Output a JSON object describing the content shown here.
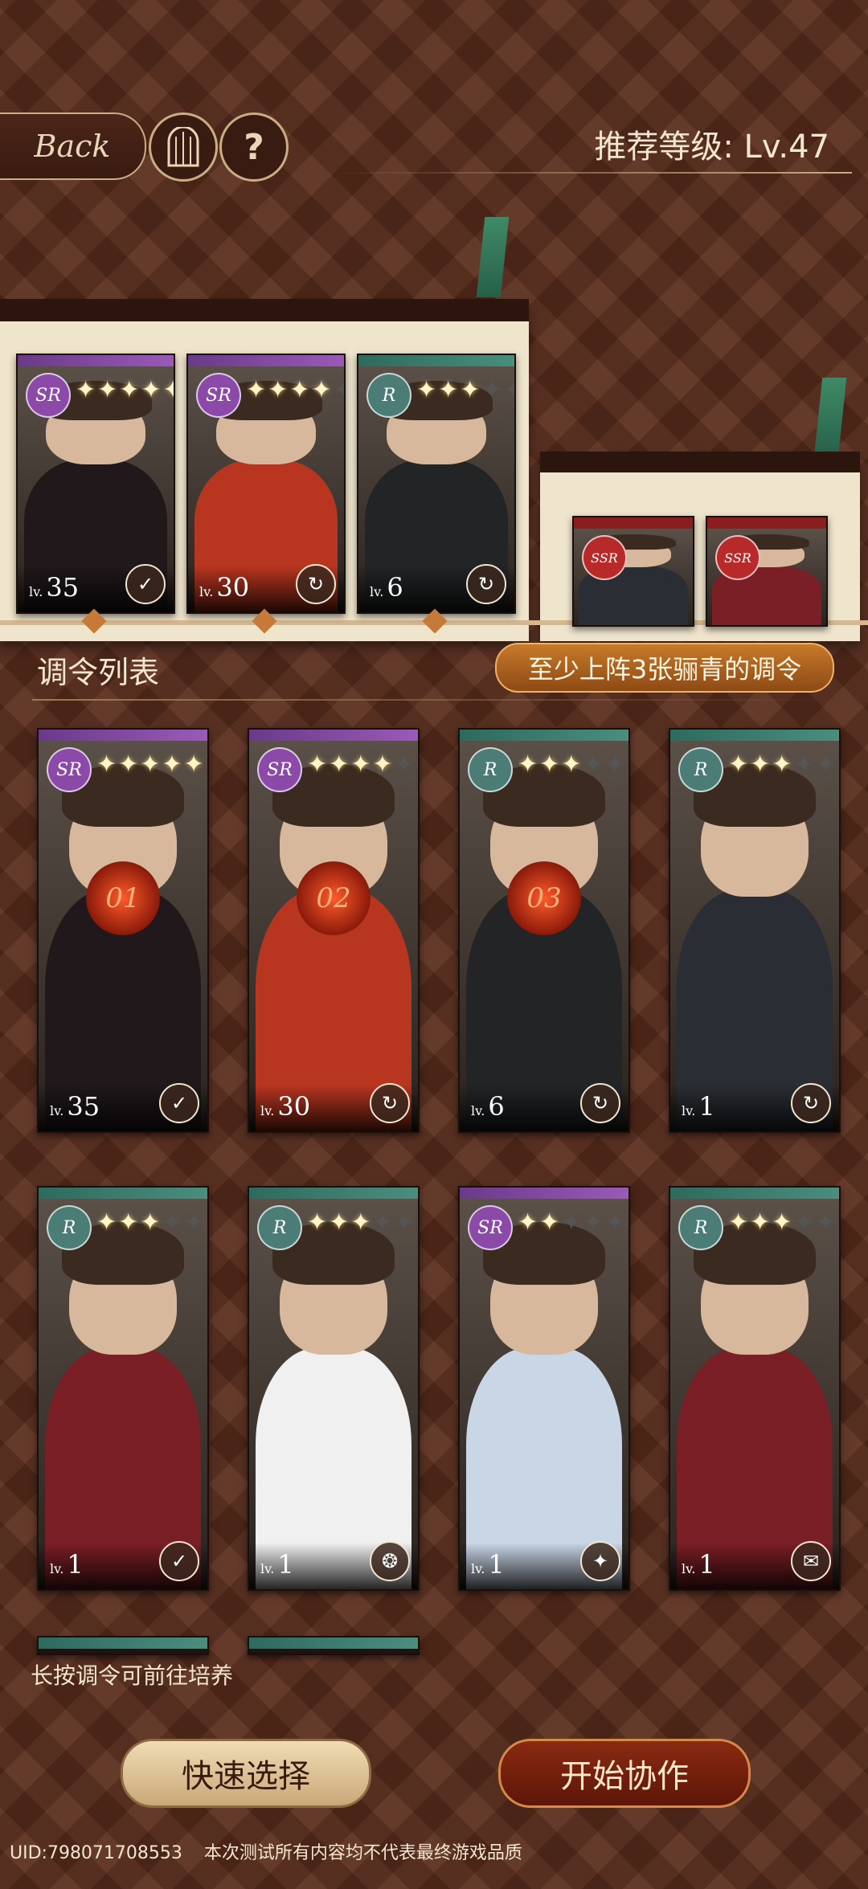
{
  "header": {
    "back_label": "Back",
    "recommended_level": "推荐等级: Lv.47"
  },
  "team_slots": [
    {
      "rarity": "SR",
      "stars": 5,
      "max_stars": 5,
      "level": "35",
      "skill": "✓"
    },
    {
      "rarity": "SR",
      "stars": 4,
      "max_stars": 5,
      "level": "30",
      "skill": "↻"
    },
    {
      "rarity": "R",
      "stars": 3,
      "max_stars": 5,
      "level": "6",
      "skill": "↻"
    }
  ],
  "support_slots": [
    {
      "rarity": "SSR"
    },
    {
      "rarity": "SSR"
    }
  ],
  "list": {
    "title": "调令列表",
    "requirement": "至少上阵3张骊青的调令",
    "cards": [
      {
        "rarity": "SR",
        "stars": 5,
        "max_stars": 5,
        "level": "35",
        "order": "01",
        "skill": "✓"
      },
      {
        "rarity": "SR",
        "stars": 4,
        "max_stars": 5,
        "level": "30",
        "order": "02",
        "skill": "↻"
      },
      {
        "rarity": "R",
        "stars": 3,
        "max_stars": 5,
        "level": "6",
        "order": "03",
        "skill": "↻"
      },
      {
        "rarity": "R",
        "stars": 3,
        "max_stars": 5,
        "level": "1",
        "order": "",
        "skill": "↻"
      },
      {
        "rarity": "R",
        "stars": 3,
        "max_stars": 5,
        "level": "1",
        "order": "",
        "skill": "✓"
      },
      {
        "rarity": "R",
        "stars": 3,
        "max_stars": 5,
        "level": "1",
        "order": "",
        "skill": "❂"
      },
      {
        "rarity": "SR",
        "stars": 2,
        "max_stars": 5,
        "level": "1",
        "order": "",
        "skill": "✦"
      },
      {
        "rarity": "R",
        "stars": 3,
        "max_stars": 5,
        "level": "1",
        "order": "",
        "skill": "✉"
      }
    ]
  },
  "hint": "长按调令可前往培养",
  "buttons": {
    "quick_select": "快速选择",
    "start": "开始协作"
  },
  "footer": {
    "uid": "UID:798071708553",
    "disclaimer": "本次测试所有内容均不代表最终游戏品质"
  },
  "colors": {
    "background": "#5a2d1d",
    "accent_gold": "#c9ad84",
    "sr_purple": "#8c4aa8",
    "r_teal": "#4b7d76",
    "start_button": "#8a2a12"
  },
  "icons": [
    "back-icon",
    "gate-icon",
    "help-icon",
    "star-icon",
    "skill-icon"
  ]
}
